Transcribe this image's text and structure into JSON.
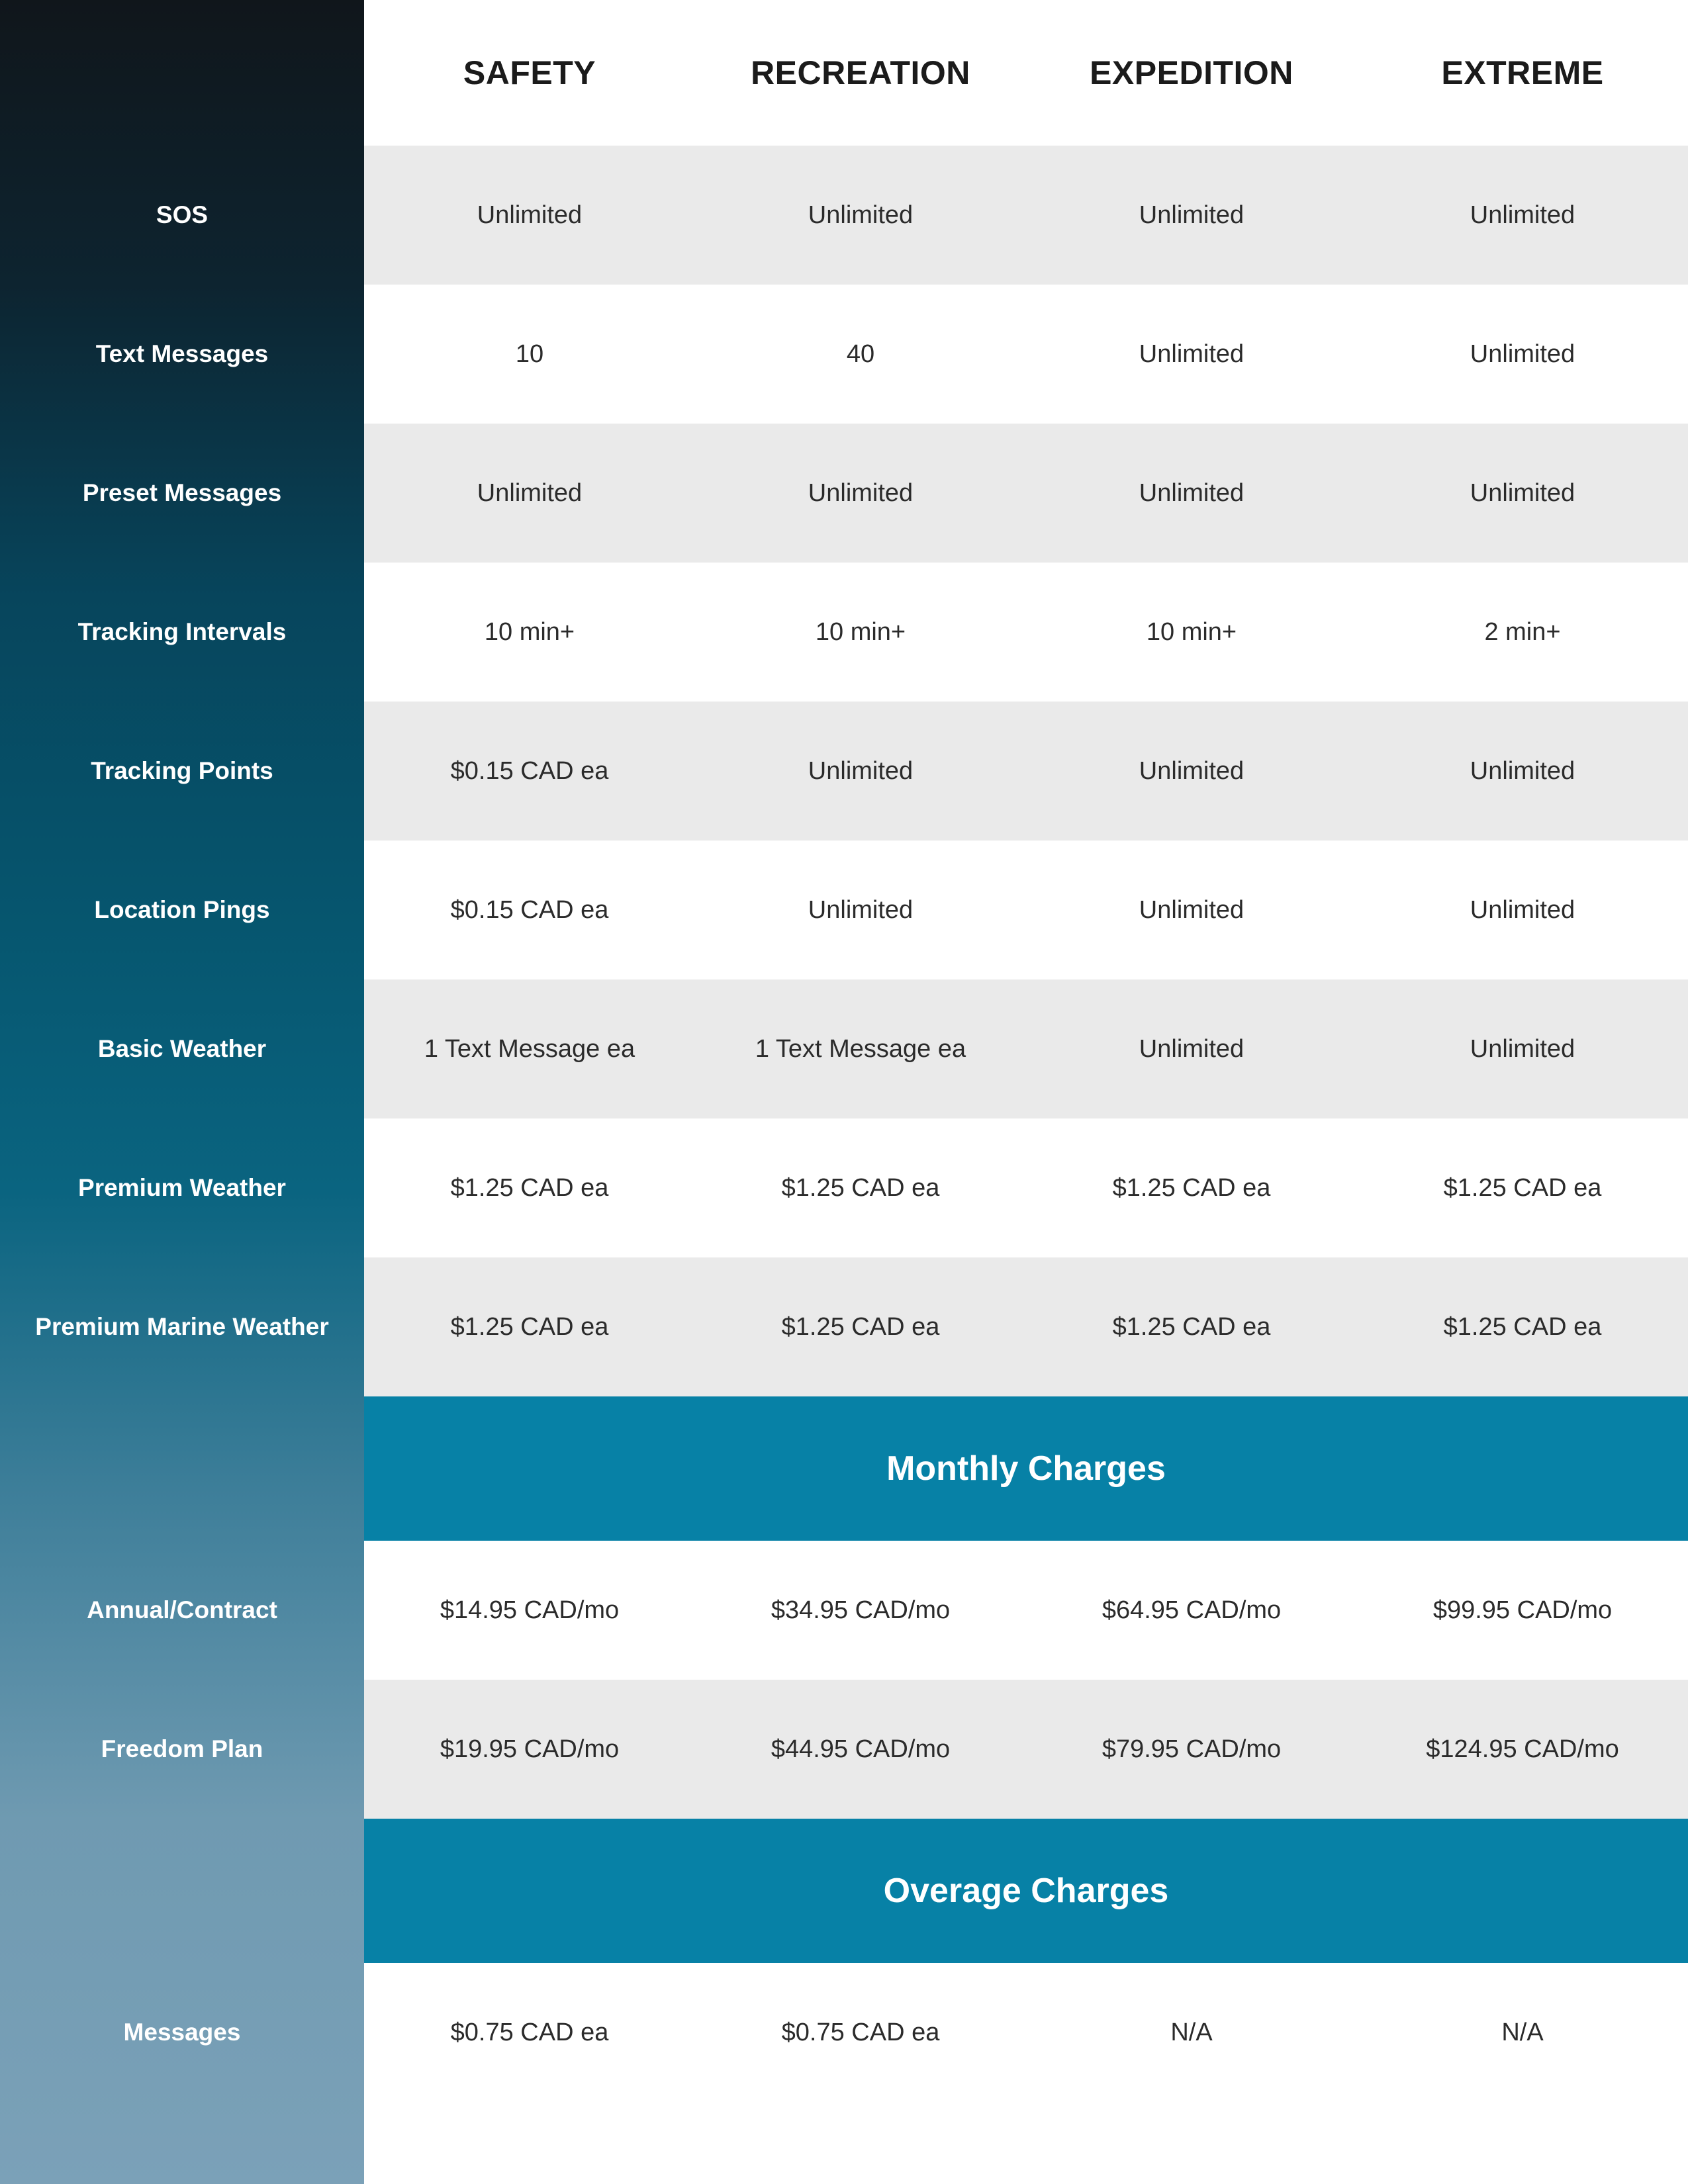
{
  "colors": {
    "banner_teal": "#0781a6",
    "row_gray": "#eaeaea",
    "row_white": "#ffffff",
    "sidebar_top": "#10161b",
    "sidebar_mid": "#06566f",
    "sidebar_bottom": "#7ba1b8",
    "header_text": "#1b1b1b",
    "data_text": "#2b2b2b",
    "sidebar_text": "#ffffff"
  },
  "header": {
    "feature_column_label": "",
    "plans": [
      {
        "name": "SAFETY"
      },
      {
        "name": "RECREATION"
      },
      {
        "name": "EXPEDITION"
      },
      {
        "name": "EXTREME"
      }
    ]
  },
  "rows": [
    {
      "kind": "data",
      "feature": "SOS",
      "values": [
        "Unlimited",
        "Unlimited",
        "Unlimited",
        "Unlimited"
      ]
    },
    {
      "kind": "data",
      "feature": "Text Messages",
      "values": [
        "10",
        "40",
        "Unlimited",
        "Unlimited"
      ]
    },
    {
      "kind": "data",
      "feature": "Preset Messages",
      "values": [
        "Unlimited",
        "Unlimited",
        "Unlimited",
        "Unlimited"
      ]
    },
    {
      "kind": "data",
      "feature": "Tracking Intervals",
      "values": [
        "10 min+",
        "10 min+",
        "10 min+",
        "2 min+"
      ]
    },
    {
      "kind": "data",
      "feature": "Tracking Points",
      "values": [
        "$0.15 CAD ea",
        "Unlimited",
        "Unlimited",
        "Unlimited"
      ]
    },
    {
      "kind": "data",
      "feature": "Location Pings",
      "values": [
        "$0.15 CAD ea",
        "Unlimited",
        "Unlimited",
        "Unlimited"
      ]
    },
    {
      "kind": "data",
      "feature": "Basic Weather",
      "values": [
        "1 Text Message ea",
        "1 Text Message ea",
        "Unlimited",
        "Unlimited"
      ]
    },
    {
      "kind": "data",
      "feature": "Premium Weather",
      "values": [
        "$1.25 CAD ea",
        "$1.25 CAD ea",
        "$1.25 CAD ea",
        "$1.25 CAD ea"
      ]
    },
    {
      "kind": "data",
      "feature": "Premium Marine Weather",
      "values": [
        "$1.25 CAD ea",
        "$1.25 CAD ea",
        "$1.25 CAD ea",
        "$1.25 CAD ea"
      ]
    },
    {
      "kind": "banner",
      "feature": "",
      "title": "Monthly Charges"
    },
    {
      "kind": "data",
      "feature": "Annual/Contract",
      "values": [
        "$14.95 CAD/mo",
        "$34.95 CAD/mo",
        "$64.95 CAD/mo",
        "$99.95 CAD/mo"
      ]
    },
    {
      "kind": "data",
      "feature": "Freedom Plan",
      "values": [
        "$19.95 CAD/mo",
        "$44.95 CAD/mo",
        "$79.95 CAD/mo",
        "$124.95 CAD/mo"
      ]
    },
    {
      "kind": "banner",
      "feature": "",
      "title": "Overage Charges"
    },
    {
      "kind": "data",
      "feature": "Messages",
      "values": [
        "$0.75 CAD ea",
        "$0.75 CAD ea",
        "N/A",
        "N/A"
      ]
    }
  ]
}
